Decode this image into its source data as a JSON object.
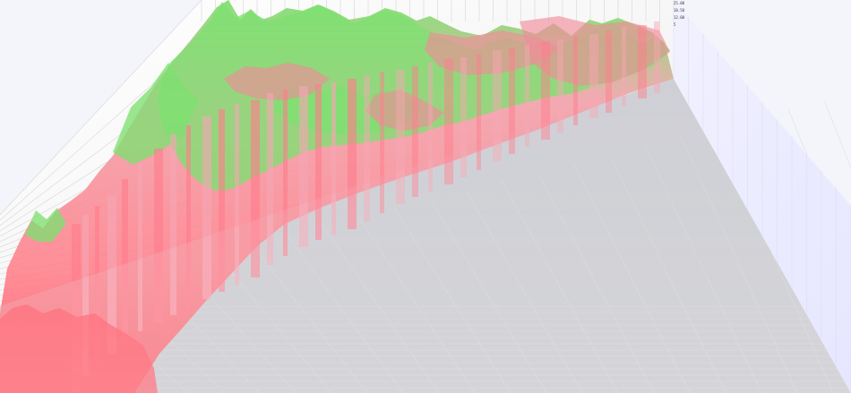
{
  "chart_data": {
    "type": "surface",
    "title": "",
    "xlabel": "",
    "ylabel": "",
    "zlabel": "",
    "axis_tick_labels": [
      "25.00",
      "18.50",
      "12.00",
      "5"
    ],
    "grid": true,
    "legend": "none",
    "colors": {
      "low": "#ff4d5a",
      "mid": "#f6a3b0",
      "high": "#79e26c",
      "floor": "#c6c7cc",
      "back_wall": "#eeeeee",
      "right_wall": "#e8e8ff",
      "grid_line": "#d6d6d6"
    }
  }
}
